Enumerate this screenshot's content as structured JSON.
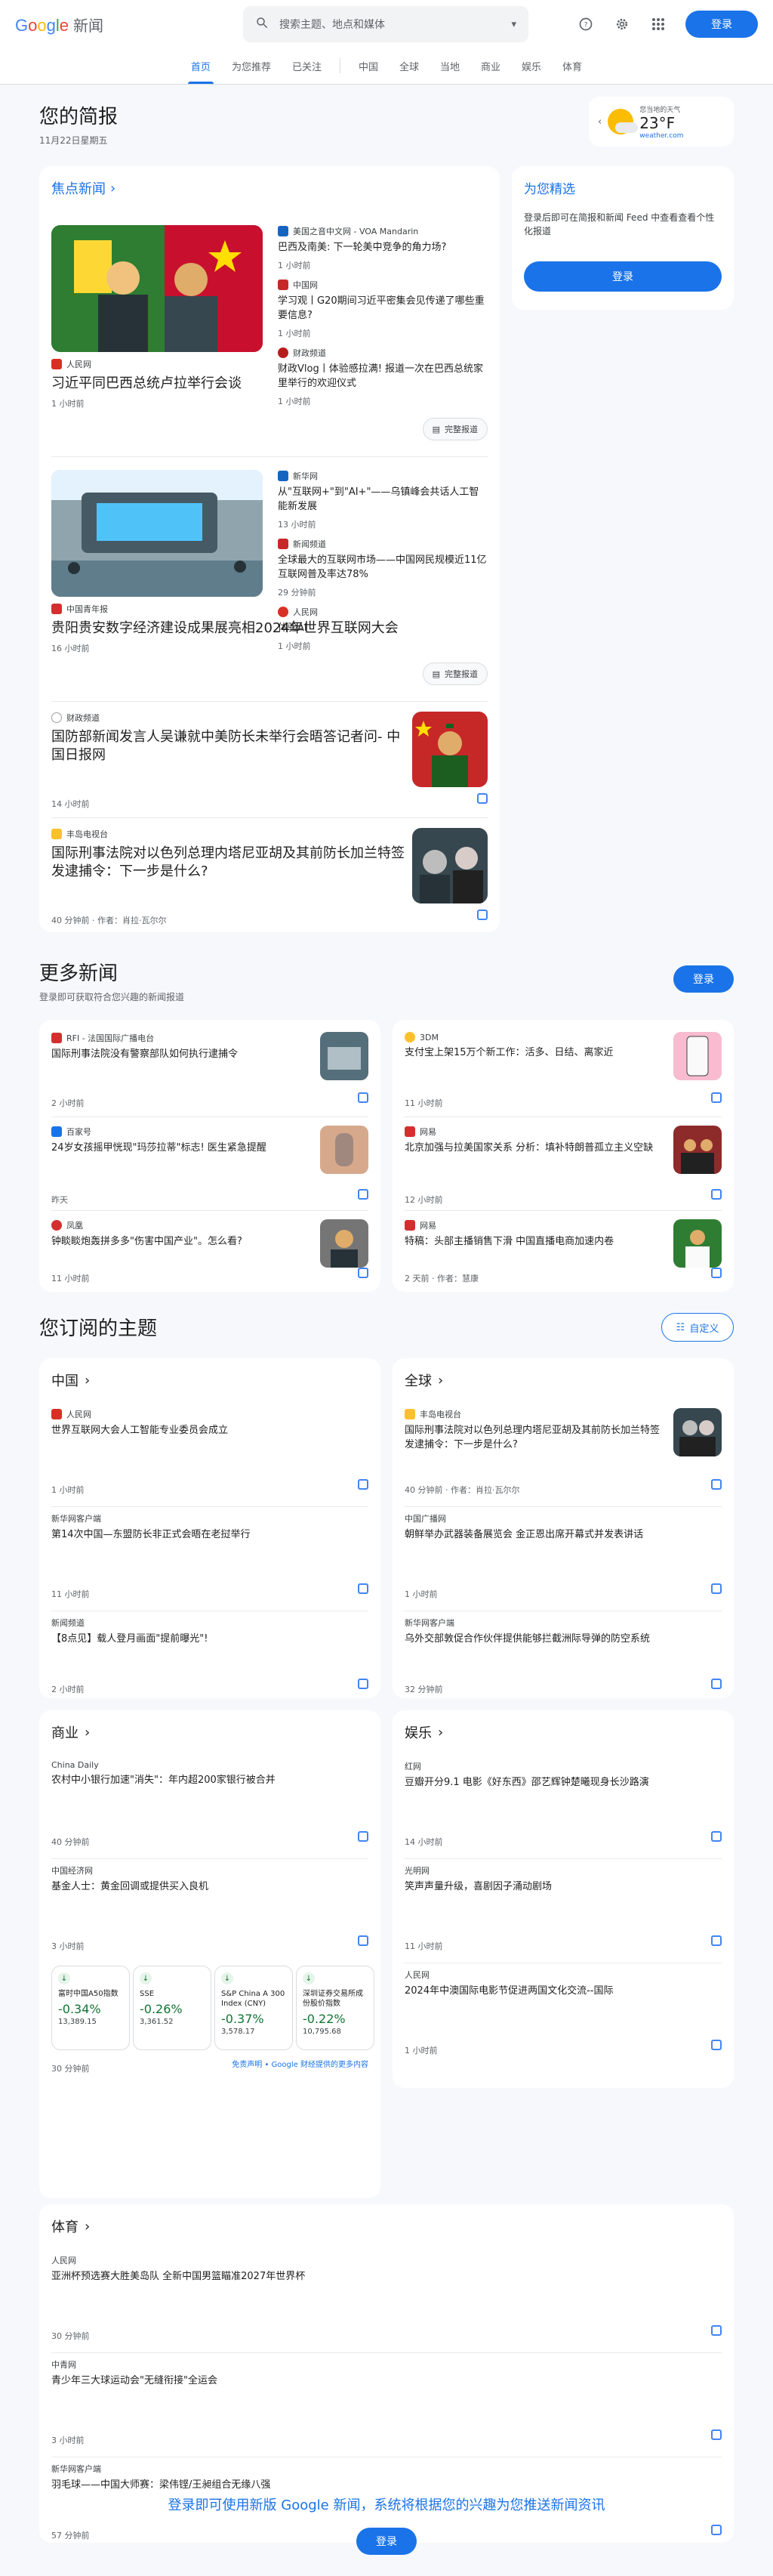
{
  "header": {
    "logo_google": "Google",
    "logo_news": "新闻",
    "search_placeholder": "搜索主题、地点和媒体",
    "login": "登录"
  },
  "nav": {
    "items": [
      "首页",
      "为您推荐",
      "已关注",
      "中国",
      "全球",
      "当地",
      "商业",
      "娱乐",
      "体育"
    ]
  },
  "briefing": {
    "title": "您的简报",
    "date": "11月22日星期五"
  },
  "weather": {
    "label": "您当地的天气",
    "temp": "23°F",
    "source": "weather.com"
  },
  "top": {
    "title": "焦点新闻",
    "c1": {
      "source": "人民网",
      "headline": "习近平同巴西总统卢拉举行会谈",
      "time": "1 小时前",
      "side": [
        {
          "source": "美国之音中文网 - VOA Mandarin",
          "headline": "巴西及南美: 下一轮美中竞争的角力场?",
          "time": "1 小时前"
        },
        {
          "source": "中国网",
          "headline": "学习观丨G20期间习近平密集会见传递了哪些重要信息?",
          "time": "1 小时前"
        },
        {
          "source": "财政频道",
          "headline": "财政Vlog丨体验感拉满! 报道一次在巴西总统家里举行的欢迎仪式",
          "time": "1 小时前"
        }
      ],
      "full": "完整报道"
    },
    "c2": {
      "source": "中国青年报",
      "headline": "贵阳贵安数字经济建设成果展亮相2024年世界互联网大会",
      "time": "16 小时前",
      "side": [
        {
          "source": "新华网",
          "headline": "从\"互联网+\"到\"AI+\"——乌镇峰会共话人工智能新发展",
          "time": "13 小时前"
        },
        {
          "source": "新闻频道",
          "headline": "全球最大的互联网市场——中国网民规模近11亿 互联网普及率达78%",
          "time": "29 分钟前"
        },
        {
          "source": "人民网",
          "headline": "体验AI",
          "time": "1 小时前"
        }
      ],
      "full": "完整报道"
    },
    "c3": {
      "source": "财政频道",
      "headline": "国防部新闻发言人吴谦就中美防长未举行会晤答记者问- 中国日报网",
      "time": "14 小时前"
    },
    "c4": {
      "source": "丰岛电视台",
      "headline": "国际刑事法院对以色列总理内塔尼亚胡及其前防长加兰特签发逮捕令：下一步是什么?",
      "time": "40 分钟前 · 作者：肖拉·瓦尔尔"
    }
  },
  "picks": {
    "title": "为您精选",
    "desc": "登录后即可在简报和新闻 Feed 中查看查看个性化报道",
    "login": "登录"
  },
  "more": {
    "title": "更多新闻",
    "desc": "登录即可获取符合您兴趣的新闻报道",
    "login": "登录",
    "items": [
      {
        "source": "RFI - 法国国际广播电台",
        "headline": "国际刑事法院没有警察部队如何执行逮捕令",
        "time": "2 小时前"
      },
      {
        "source": "3DM",
        "headline": "支付宝上架15万个新工作：活多、日结、离家近",
        "time": "11 小时前"
      },
      {
        "source": "百家号",
        "headline": "24岁女孩摇甲恍现\"玛莎拉蒂\"标志! 医生紧急提醒",
        "time": "昨天"
      },
      {
        "source": "网易",
        "headline": "北京加强与拉美国家关系 分析：填补特朗普孤立主义空缺",
        "time": "12 小时前"
      },
      {
        "source": "凤凰",
        "headline": "钟睒睒炮轰拼多多\"伤害中国产业\"。怎么看?",
        "time": "11 小时前"
      },
      {
        "source": "网易",
        "headline": "特稿：头部主播销售下滑 中国直播电商加速内卷",
        "time": "2 天前 · 作者：慧康"
      }
    ]
  },
  "topics": {
    "title": "您订阅的主题",
    "customize": "自定义",
    "china": {
      "title": "中国",
      "items": [
        {
          "source": "人民网",
          "headline": "世界互联网大会人工智能专业委员会成立",
          "time": "1 小时前"
        },
        {
          "source": "新华网客户端",
          "headline": "第14次中国—东盟防长非正式会晤在老挝举行",
          "time": "11 小时前"
        },
        {
          "source": "新闻频道",
          "headline": "【8点见】载人登月画面\"提前曝光\"!",
          "time": "2 小时前"
        }
      ]
    },
    "world": {
      "title": "全球",
      "items": [
        {
          "source": "丰岛电视台",
          "headline": "国际刑事法院对以色列总理内塔尼亚胡及其前防长加兰特签发逮捕令：下一步是什么?",
          "time": "40 分钟前 · 作者：肖拉·瓦尔尔"
        },
        {
          "source": "中国广播网",
          "headline": "朝鲜举办武器装备展览会 金正恩出席开幕式并发表讲话",
          "time": "1 小时前"
        },
        {
          "source": "新华网客户端",
          "headline": "乌外交部敦促合作伙伴提供能够拦截洲际导弹的防空系统",
          "time": "32 分钟前"
        }
      ]
    },
    "biz": {
      "title": "商业",
      "items": [
        {
          "source": "China Daily",
          "headline": "农村中小银行加速\"消失\"：年内超200家银行被合并",
          "time": "40 分钟前"
        },
        {
          "source": "中国经济网",
          "headline": "基金人士：黄金回调或提供买入良机",
          "time": "3 小时前"
        }
      ],
      "stocks": [
        {
          "name": "富时中国A50指数",
          "change": "-0.34%",
          "price": "13,389.15"
        },
        {
          "name": "SSE",
          "change": "-0.26%",
          "price": "3,361.52"
        },
        {
          "name": "S&P China A 300 Index (CNY)",
          "change": "-0.37%",
          "price": "3,578.17"
        },
        {
          "name": "深圳证券交易所成份股价指数",
          "change": "-0.22%",
          "price": "10,795.68"
        }
      ],
      "time": "30 分钟前",
      "disclaimer": "免责声明 • Google 财经提供的更多内容"
    },
    "ent": {
      "title": "娱乐",
      "items": [
        {
          "source": "红网",
          "headline": "豆瓣开分9.1 电影《好东西》邵艺辉钟楚曦现身长沙路演",
          "time": "14 小时前"
        },
        {
          "source": "光明网",
          "headline": "笑声声量升级，喜剧因子涌动剧场",
          "time": "11 小时前"
        },
        {
          "source": "人民网",
          "headline": "2024年中澳国际电影节促进两国文化交流--国际",
          "time": "1 小时前"
        }
      ]
    },
    "sports": {
      "title": "体育",
      "items": [
        {
          "source": "人民网",
          "headline": "亚洲杯预选赛大胜美岛队 全新中国男篮瞄准2027年世界杯",
          "time": "30 分钟前"
        },
        {
          "source": "中青网",
          "headline": "青少年三大球运动会\"无缝衔接\"全运会",
          "time": "3 小时前"
        },
        {
          "source": "新华网客户端",
          "headline": "羽毛球——中国大师赛：梁伟铿/王昶组合无缘八强",
          "time": "57 分钟前"
        }
      ]
    }
  },
  "footer": {
    "text": "登录即可使用新版 Google 新闻，系统将根据您的兴趣为您推送新闻资讯",
    "login": "登录"
  },
  "colors": {
    "accent": "#1a73e8",
    "bg": "#f6f8fc",
    "card": "#ffffff",
    "down": "#137333"
  }
}
